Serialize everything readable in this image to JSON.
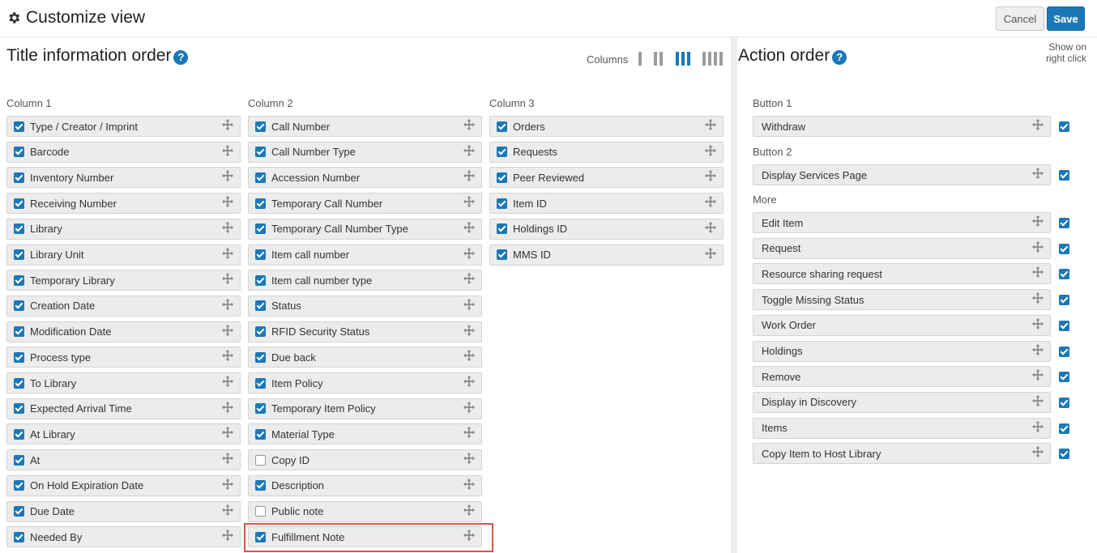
{
  "header": {
    "title": "Customize view",
    "cancel_label": "Cancel",
    "save_label": "Save"
  },
  "left_panel": {
    "title": "Title information order",
    "columns_label": "Columns",
    "column_count_selected": 3,
    "col1": {
      "heading": "Column 1",
      "items": [
        {
          "label": "Type / Creator / Imprint",
          "checked": true
        },
        {
          "label": "Barcode",
          "checked": true
        },
        {
          "label": "Inventory Number",
          "checked": true
        },
        {
          "label": "Receiving Number",
          "checked": true
        },
        {
          "label": "Library",
          "checked": true
        },
        {
          "label": "Library Unit",
          "checked": true
        },
        {
          "label": "Temporary Library",
          "checked": true
        },
        {
          "label": "Creation Date",
          "checked": true
        },
        {
          "label": "Modification Date",
          "checked": true
        },
        {
          "label": "Process type",
          "checked": true
        },
        {
          "label": "To Library",
          "checked": true
        },
        {
          "label": "Expected Arrival Time",
          "checked": true
        },
        {
          "label": "At Library",
          "checked": true
        },
        {
          "label": "At",
          "checked": true
        },
        {
          "label": "On Hold Expiration Date",
          "checked": true
        },
        {
          "label": "Due Date",
          "checked": true
        },
        {
          "label": "Needed By",
          "checked": true
        }
      ]
    },
    "col2": {
      "heading": "Column 2",
      "items": [
        {
          "label": "Call Number",
          "checked": true
        },
        {
          "label": "Call Number Type",
          "checked": true
        },
        {
          "label": "Accession Number",
          "checked": true
        },
        {
          "label": "Temporary Call Number",
          "checked": true
        },
        {
          "label": "Temporary Call Number Type",
          "checked": true
        },
        {
          "label": "Item call number",
          "checked": true
        },
        {
          "label": "Item call number type",
          "checked": true
        },
        {
          "label": "Status",
          "checked": true
        },
        {
          "label": "RFID Security Status",
          "checked": true
        },
        {
          "label": "Due back",
          "checked": true
        },
        {
          "label": "Item Policy",
          "checked": true
        },
        {
          "label": "Temporary Item Policy",
          "checked": true
        },
        {
          "label": "Material Type",
          "checked": true
        },
        {
          "label": "Copy ID",
          "checked": false
        },
        {
          "label": "Description",
          "checked": true
        },
        {
          "label": "Public note",
          "checked": false
        },
        {
          "label": "Fulfillment Note",
          "checked": true
        }
      ]
    },
    "col3": {
      "heading": "Column 3",
      "items": [
        {
          "label": "Orders",
          "checked": true
        },
        {
          "label": "Requests",
          "checked": true
        },
        {
          "label": "Peer Reviewed",
          "checked": true
        },
        {
          "label": "Item ID",
          "checked": true
        },
        {
          "label": "Holdings ID",
          "checked": true
        },
        {
          "label": "MMS ID",
          "checked": true
        }
      ]
    }
  },
  "right_panel": {
    "title": "Action order",
    "show_on_right_click_label": "Show on right click",
    "button1": {
      "label": "Button 1",
      "items": [
        {
          "label": "Withdraw",
          "checked": true
        }
      ]
    },
    "button2": {
      "label": "Button 2",
      "items": [
        {
          "label": "Display Services Page",
          "checked": true
        }
      ]
    },
    "more": {
      "label": "More",
      "items": [
        {
          "label": "Edit Item",
          "checked": true
        },
        {
          "label": "Request",
          "checked": true
        },
        {
          "label": "Resource sharing request",
          "checked": true
        },
        {
          "label": "Toggle Missing Status",
          "checked": true
        },
        {
          "label": "Work Order",
          "checked": true
        },
        {
          "label": "Holdings",
          "checked": true
        },
        {
          "label": "Remove",
          "checked": true
        },
        {
          "label": "Display in Discovery",
          "checked": true
        },
        {
          "label": "Items",
          "checked": true
        },
        {
          "label": "Copy Item to Host Library",
          "checked": true
        }
      ]
    }
  },
  "colors": {
    "accent": "#1a78b8",
    "highlight": "#d9534f"
  }
}
